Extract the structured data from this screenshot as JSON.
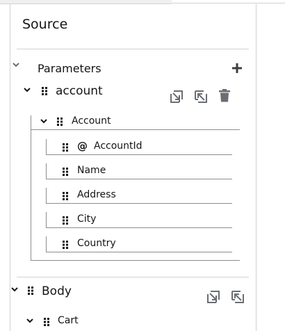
{
  "panel": {
    "title": "Source"
  },
  "parameters": {
    "label": "Parameters",
    "add_icon": "plus-icon"
  },
  "account_param": {
    "label": "account",
    "actions": [
      "export-icon",
      "import-icon",
      "trash-icon"
    ]
  },
  "account_type": {
    "label": "Account",
    "fields": [
      {
        "label": "AccountId",
        "attribute": true,
        "attr_symbol": "@"
      },
      {
        "label": "Name"
      },
      {
        "label": "Address"
      },
      {
        "label": "City"
      },
      {
        "label": "Country"
      }
    ]
  },
  "body": {
    "label": "Body",
    "actions": [
      "export-icon",
      "import-icon"
    ]
  },
  "cart": {
    "label": "Cart"
  }
}
